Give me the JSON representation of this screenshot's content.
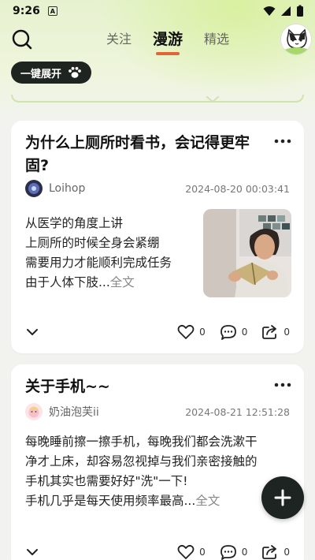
{
  "status_bar": {
    "time": "9:26",
    "badge": "A"
  },
  "nav": {
    "tabs": [
      {
        "label": "关注",
        "active": false
      },
      {
        "label": "漫游",
        "active": true
      },
      {
        "label": "精选",
        "active": false
      }
    ],
    "accent_color": "#e0663a"
  },
  "expand_button": {
    "label": "一键展开"
  },
  "posts": [
    {
      "title": "为什么上厕所时看书，会记得更牢固?",
      "author": "Loihop",
      "time": "2024-08-20 00:03:41",
      "body_lines": [
        "从医学的角度上讲",
        "上厕所的时候全身会紧绷",
        "需要用力才能顺利完成任务",
        "由于人体下肢..."
      ],
      "more": "全文",
      "likes": "0",
      "comments": "0",
      "shares": "0"
    },
    {
      "title": "关于手机~~",
      "author": "奶油泡芙ii",
      "time": "2024-08-21 12:51:28",
      "body_lines": [
        "每晚睡前擦一擦手机，每晚我们都会洗漱干",
        "净才上床，却容易忽视掉与我们亲密接触的",
        "手机其实也需要好好\"洗\"一下!",
        "手机几乎是每天使用频率最高..."
      ],
      "more": "全文",
      "likes": "0",
      "comments": "0",
      "shares": "0"
    }
  ],
  "icons": [
    "search-icon",
    "paw-icon",
    "more-icon",
    "chevron-down-icon",
    "heart-icon",
    "comment-icon",
    "share-icon",
    "plus-icon"
  ]
}
